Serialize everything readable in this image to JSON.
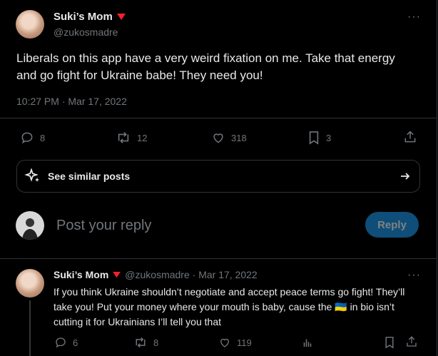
{
  "main_post": {
    "author_name": "Suki’s Mom",
    "handle": "@zukosmadre",
    "text": "Liberals on this app have a very weird fixation on me. Take that energy and go fight for Ukraine babe! They need you!",
    "timestamp": "10:27 PM · Mar 17, 2022",
    "stats": {
      "replies": "8",
      "reposts": "12",
      "likes": "318",
      "bookmarks": "3"
    }
  },
  "similar_posts": {
    "label": "See similar posts"
  },
  "reply_box": {
    "placeholder": "Post your reply",
    "button_label": "Reply"
  },
  "reply_post": {
    "author_name": "Suki’s Mom",
    "handle_date": "@zukosmadre · Mar 17, 2022",
    "text": "If you think Ukraine shouldn’t negotiate and accept peace terms go fight! They’ll take you! Put your money where your mouth is baby, cause the 🇺🇦 in bio isn’t cutting it for Ukrainians I’ll tell you that",
    "stats": {
      "replies": "6",
      "reposts": "8",
      "likes": "119"
    }
  },
  "colors": {
    "accent": "#1d9bf0",
    "reply_button_bg": "#0f4e78",
    "badge": "#f4212e"
  }
}
